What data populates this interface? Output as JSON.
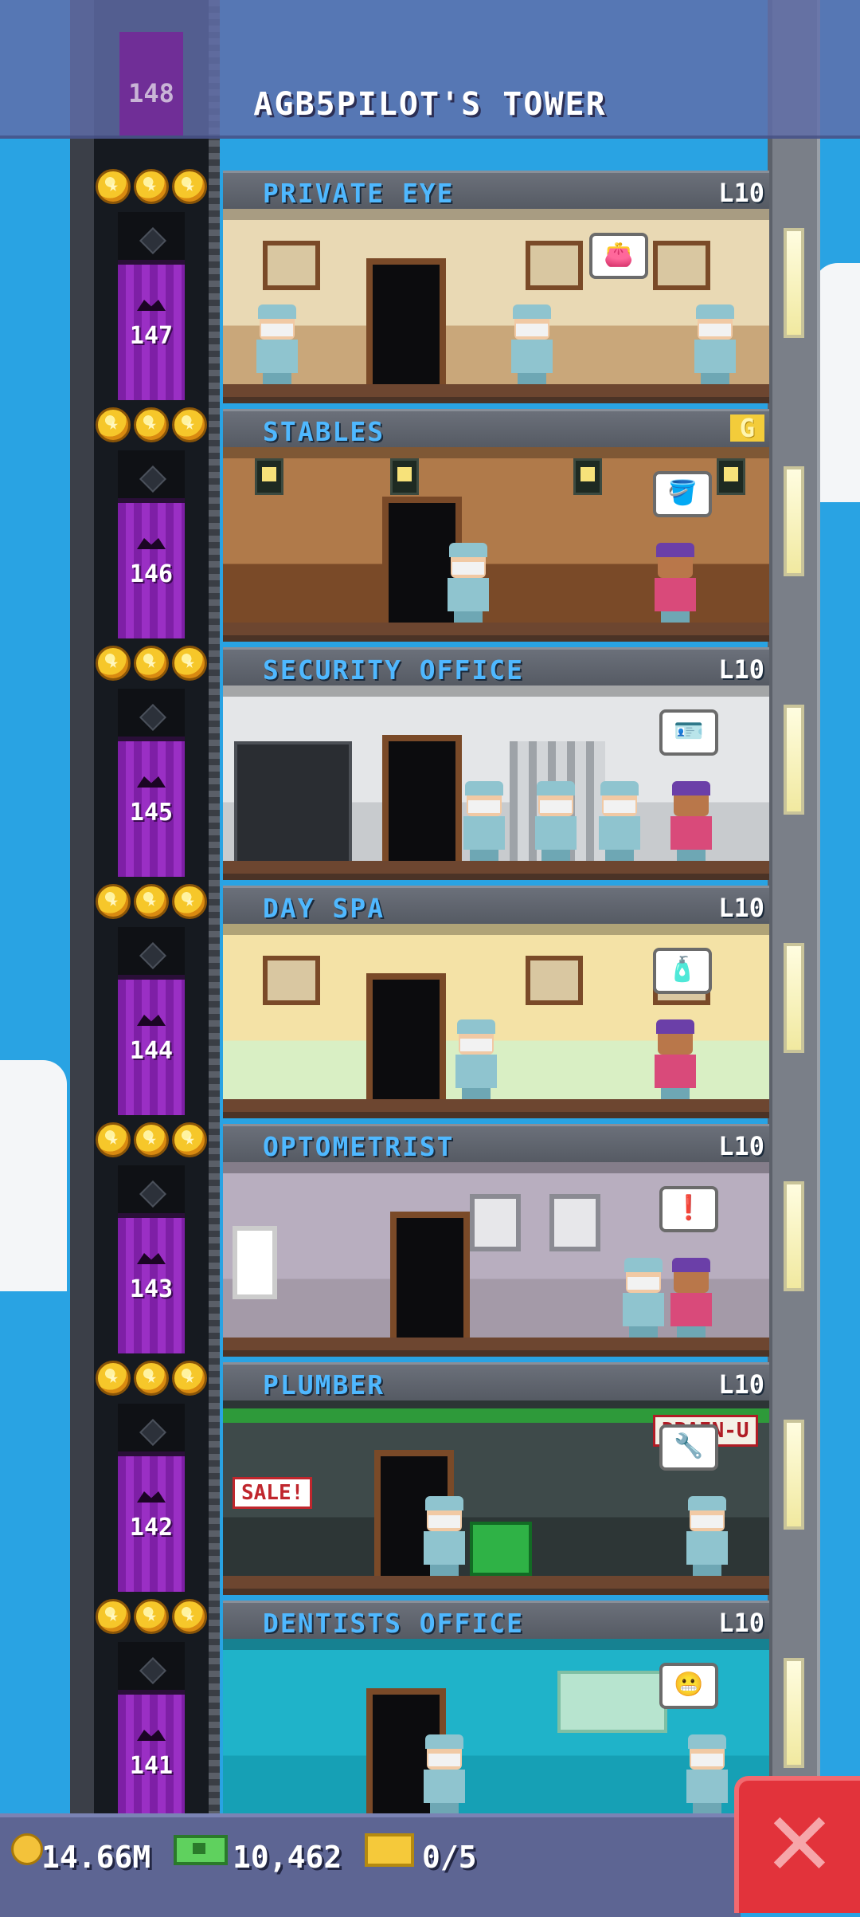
{
  "header": {
    "title": "AGB5PILOT'S TOWER",
    "top_floor_number": "148"
  },
  "floors": [
    {
      "number": "147",
      "name": "PRIVATE EYE",
      "level": "L10",
      "stars": 3,
      "bubble": "👛"
    },
    {
      "number": "146",
      "name": "STABLES",
      "level": "G",
      "stars": 3,
      "bubble": "🪣"
    },
    {
      "number": "145",
      "name": "SECURITY OFFICE",
      "level": "L10",
      "stars": 3,
      "bubble": "🪪"
    },
    {
      "number": "144",
      "name": "DAY SPA",
      "level": "L10",
      "stars": 3,
      "bubble": "🧴"
    },
    {
      "number": "143",
      "name": "OPTOMETRIST",
      "level": "L10",
      "stars": 3,
      "bubble": "❗"
    },
    {
      "number": "142",
      "name": "PLUMBER",
      "level": "L10",
      "stars": 3,
      "bubble": "🔧"
    },
    {
      "number": "141",
      "name": "DENTISTS OFFICE",
      "level": "L10",
      "stars": 3,
      "bubble": "😬"
    }
  ],
  "room_signs": {
    "plumber_sign": "DRAIN-U",
    "plumber_sale": "SALE!"
  },
  "resources": {
    "coins": "14.66M",
    "bux": "10,462",
    "golden_tickets": "0/5"
  },
  "icons": {
    "coins": "coin-icon",
    "bux": "cash-icon",
    "tickets": "ticket-icon",
    "close": "close-icon",
    "star": "star-icon"
  },
  "colors": {
    "sky": "#29a3e3",
    "elevator": "#8a24b4",
    "room_label": "#4fb8ff",
    "close_button": "#e2333b"
  }
}
